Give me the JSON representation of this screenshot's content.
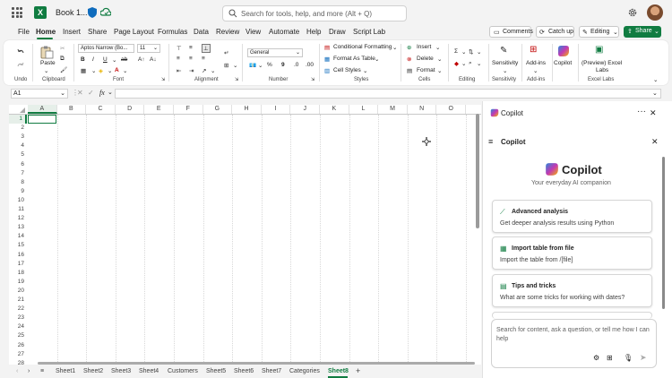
{
  "title_bar": {
    "doc_title": "Book 1...",
    "search_placeholder": "Search for tools, help, and more (Alt + Q)"
  },
  "menu": {
    "items": [
      "File",
      "Home",
      "Insert",
      "Share",
      "Page Layout",
      "Formulas",
      "Data",
      "Review",
      "View",
      "Automate",
      "Help",
      "Draw",
      "Script Lab"
    ],
    "active": "Home"
  },
  "header_buttons": {
    "comments": "Comments",
    "catch_up": "Catch up",
    "editing": "Editing",
    "share": "Share"
  },
  "ribbon": {
    "undo_label": "Undo",
    "clipboard_label": "Clipboard",
    "paste_label": "Paste",
    "font_label": "Font",
    "font_name": "Aptos Narrow (Bo...",
    "font_size": "11",
    "alignment_label": "Alignment",
    "number_label": "Number",
    "number_format": "General",
    "styles_label": "Styles",
    "conditional_formatting": "Conditional Formatting",
    "format_as_table": "Format As Table",
    "cell_styles": "Cell Styles",
    "cells_label": "Cells",
    "insert": "Insert",
    "delete": "Delete",
    "format": "Format",
    "editing_label": "Editing",
    "sensitivity": "Sensitivity",
    "sensitivity_group": "Sensitivity",
    "addins": "Add-ins",
    "addins_group": "Add-ins",
    "copilot": "Copilot",
    "excel_labs_btn_1": "(Preview) Excel",
    "excel_labs_btn_2": "Labs",
    "excel_labs_group": "Excel Labs"
  },
  "formula_bar": {
    "name_box": "A1",
    "fx": "fx"
  },
  "grid": {
    "columns": [
      "A",
      "B",
      "C",
      "D",
      "E",
      "F",
      "G",
      "H",
      "I",
      "J",
      "K",
      "L",
      "M",
      "N",
      "O"
    ],
    "rows": [
      "1",
      "2",
      "3",
      "4",
      "5",
      "6",
      "7",
      "8",
      "9",
      "10",
      "11",
      "12",
      "13",
      "14",
      "15",
      "16",
      "17",
      "18",
      "19",
      "20",
      "21",
      "22",
      "23",
      "24",
      "25",
      "26",
      "27",
      "28"
    ]
  },
  "sheets": {
    "tabs": [
      "Sheet1",
      "Sheet2",
      "Sheet3",
      "Sheet4",
      "Customers",
      "Sheet5",
      "Sheet6",
      "Sheet7",
      "Categories",
      "Sheet8"
    ],
    "active": "Sheet8"
  },
  "copilot_pane": {
    "header": "Copilot",
    "subheader": "Copilot",
    "brand": "Copilot",
    "tagline": "Your everyday AI companion",
    "cards": [
      {
        "title": "Advanced analysis",
        "desc": "Get deeper analysis results using Python"
      },
      {
        "title": "Import table from file",
        "desc": "Import the table from /[file]"
      },
      {
        "title": "Tips and tricks",
        "desc": "What are some tricks for working with dates?"
      }
    ],
    "composer_placeholder": "Search for content, ask a question, or tell me how I can help"
  },
  "colors": {
    "excel_green": "#107c41",
    "copilot_gradient": [
      "#2b88d8",
      "#c239b3",
      "#f7b500"
    ]
  }
}
